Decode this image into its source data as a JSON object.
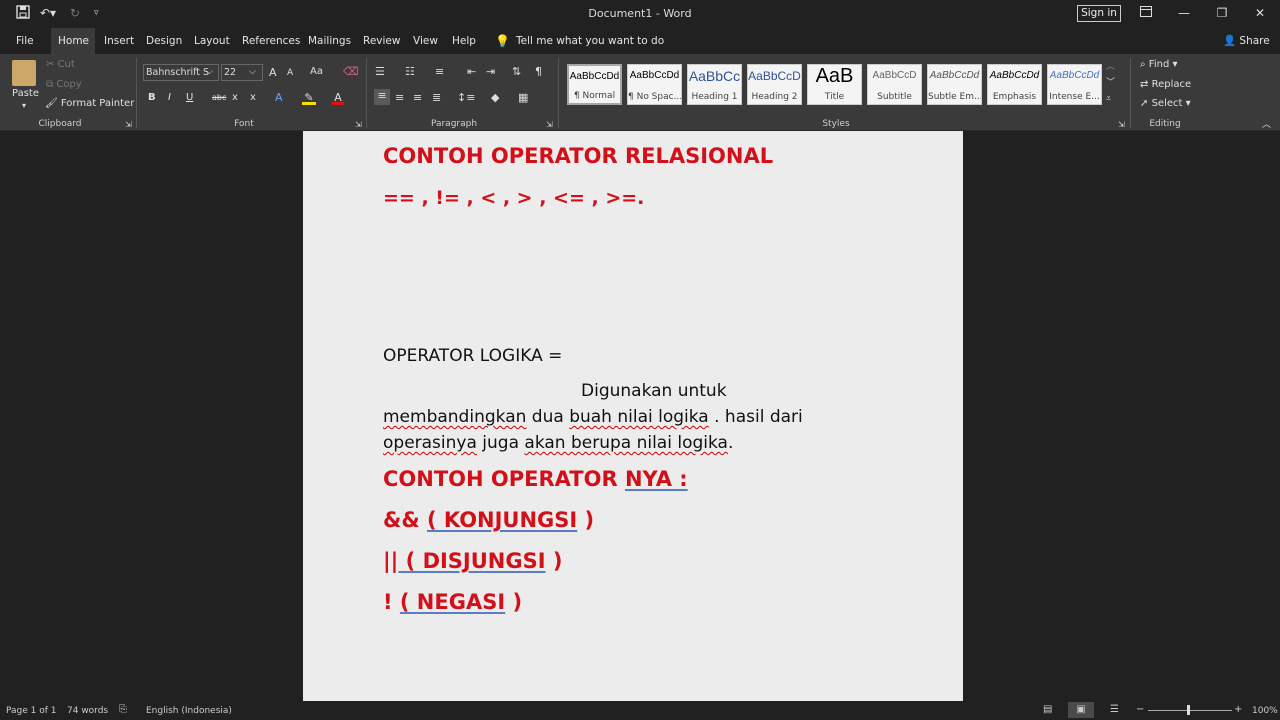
{
  "titlebar": {
    "title": "Document1  -  Word",
    "signin": "Sign in"
  },
  "menu": {
    "tabs": [
      "File",
      "Home",
      "Insert",
      "Design",
      "Layout",
      "References",
      "Mailings",
      "Review",
      "View",
      "Help"
    ],
    "tell_me": "Tell me what you want to do",
    "share": "Share"
  },
  "ribbon": {
    "clipboard": {
      "paste": "Paste",
      "cut": "Cut",
      "copy": "Copy",
      "format_painter": "Format Painter",
      "label": "Clipboard"
    },
    "font": {
      "name": "Bahnschrift S",
      "size": "22",
      "label": "Font",
      "grow": "A",
      "shrink": "A",
      "case": "Aa",
      "bold": "B",
      "italic": "I",
      "underline": "U",
      "strike": "abc",
      "sub": "x",
      "sup": "x"
    },
    "paragraph": {
      "label": "Paragraph",
      "pilcrow": "¶"
    },
    "styles": {
      "label": "Styles",
      "items": [
        {
          "preview": "AaBbCcDd",
          "name": "¶ Normal"
        },
        {
          "preview": "AaBbCcDd",
          "name": "¶ No Spac..."
        },
        {
          "preview": "AaBbCc",
          "name": "Heading 1"
        },
        {
          "preview": "AaBbCcD",
          "name": "Heading 2"
        },
        {
          "preview": "AaB",
          "name": "Title"
        },
        {
          "preview": "AaBbCcD",
          "name": "Subtitle"
        },
        {
          "preview": "AaBbCcDd",
          "name": "Subtle Em..."
        },
        {
          "preview": "AaBbCcDd",
          "name": "Emphasis"
        },
        {
          "preview": "AaBbCcDd",
          "name": "Intense E..."
        }
      ]
    },
    "editing": {
      "find": "Find",
      "replace": "Replace",
      "select": "Select",
      "label": "Editing"
    }
  },
  "document": {
    "heading1": "CONTOH OPERATOR RELASIONAL",
    "operators": "== , != , < , > , <= , >=.",
    "logika_title": "OPERATOR LOGIKA =",
    "desc1": "Digunakan untuk",
    "desc2_a": "membandingkan",
    "desc2_b": " dua ",
    "desc2_c": "buah nilai logika",
    "desc2_d": " . hasil dari",
    "desc3_a": "operasinya",
    "desc3_b": " juga ",
    "desc3_c": "akan berupa nilai logika",
    "desc3_d": ".",
    "contoh_a": "CONTOH OPERATOR ",
    "contoh_b": "NYA :",
    "and_a": "&& ",
    "and_b": "( KONJUNGSI",
    "and_c": " )",
    "or_a": "||",
    "or_b": " ( DISJUNGSI",
    "or_c": " )",
    "not_a": "! ",
    "not_b": "( NEGASI",
    "not_c": " )"
  },
  "status": {
    "page": "Page 1 of 1",
    "words": "74 words",
    "language": "English (Indonesia)",
    "zoom": "100%"
  },
  "colors": {
    "accent_red": "#d11019",
    "ribbon_bg": "#3a3a3a",
    "title_bg": "#212121"
  }
}
